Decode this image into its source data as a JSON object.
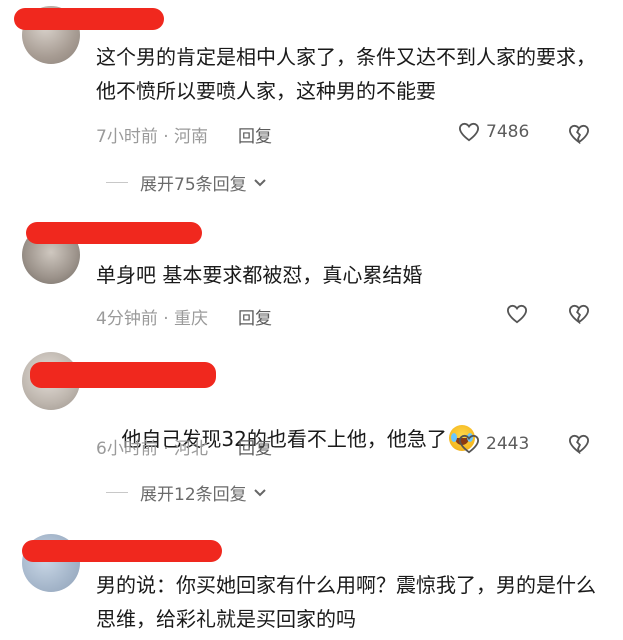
{
  "comments": [
    {
      "text": "这个男的肯定是相中人家了，条件又达不到人家的要求，他不愤所以要喷人家，这种男的不能要",
      "time_location": "7小时前 · 河南",
      "reply_label": "回复",
      "likes": "7486",
      "expand_label": "展开75条回复"
    },
    {
      "text": "单身吧 基本要求都被怼，真心累结婚",
      "time_location": "4分钟前 · 重庆",
      "reply_label": "回复",
      "likes": ""
    },
    {
      "text": "他自己发现32的也看不上他，他急了",
      "emoji": "laughing-crying-emoji",
      "time_location": "6小时前 · 河北",
      "reply_label": "回复",
      "likes": "2443",
      "expand_label": "展开12条回复"
    },
    {
      "text": "男的说：你买她回家有什么用啊？震惊我了，男的是什么思维，给彩礼就是买回家的吗"
    }
  ],
  "colors": {
    "redaction": "#f0281e",
    "meta": "#9a9a9a",
    "text": "#1a1a1a"
  },
  "icons": {
    "like": "heart-outline-icon",
    "dislike": "broken-heart-icon",
    "expand": "chevron-down-icon"
  }
}
